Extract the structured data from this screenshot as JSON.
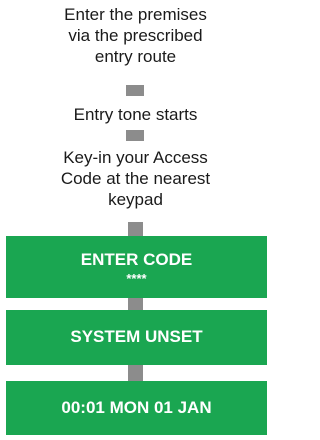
{
  "colors": {
    "box_fill": "#1aa651",
    "connector": "#8c8c8c",
    "text": "#1a1a1a",
    "box_text": "#ffffff"
  },
  "steps": [
    {
      "text": "Enter the premises\nvia the prescribed\nentry route"
    },
    {
      "text": "Entry tone starts"
    },
    {
      "text": "Key-in your Access\nCode at the nearest\nkeypad"
    }
  ],
  "boxes": [
    {
      "title": "ENTER CODE",
      "subtitle": "****"
    },
    {
      "title": "SYSTEM UNSET"
    },
    {
      "title": "00:01 MON 01 JAN"
    }
  ]
}
